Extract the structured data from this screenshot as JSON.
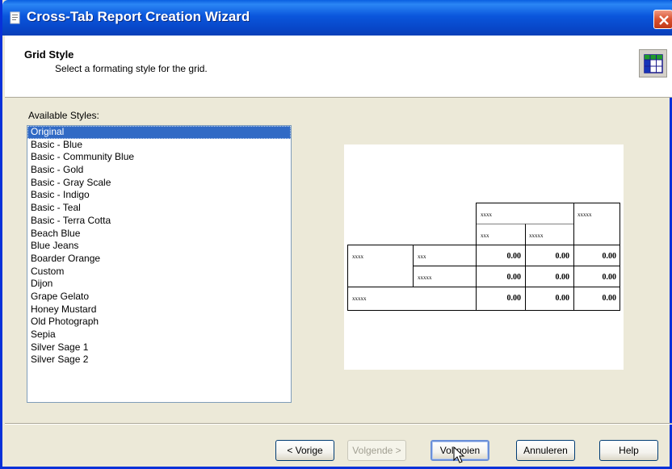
{
  "window": {
    "title": "Cross-Tab Report Creation Wizard"
  },
  "header": {
    "title": "Grid Style",
    "subtitle": "Select a formating style for the grid."
  },
  "styles": {
    "label": "Available Styles:",
    "selected": "Original",
    "items": [
      "Original",
      "Basic - Blue",
      "Basic - Community Blue",
      "Basic - Gold",
      "Basic - Gray Scale",
      "Basic - Indigo",
      "Basic - Teal",
      "Basic - Terra Cotta",
      "Beach Blue",
      "Blue Jeans",
      "Boarder Orange",
      "Custom",
      "Dijon",
      "Grape Gelato",
      "Honey Mustard",
      "Old Photograph",
      "Sepia",
      "Silver Sage 1",
      "Silver Sage 2"
    ]
  },
  "preview": {
    "col_header_1": "xxxx",
    "col_header_total": "xxxxx",
    "sub_col_1": "xxx",
    "sub_col_2": "xxxxx",
    "row_header_1": "xxxx",
    "row_sub_1": "xxx",
    "row_sub_2": "xxxxx",
    "row_total": "xxxxx",
    "cell_value": "0.00"
  },
  "buttons": {
    "back": "< Vorige",
    "next": "Volgende >",
    "finish": "Voltooien",
    "cancel": "Annuleren",
    "help": "Help"
  },
  "colors": {
    "titlebar": "#0a56dc",
    "selection": "#316ac5",
    "dialog_bg": "#ece9d8"
  }
}
